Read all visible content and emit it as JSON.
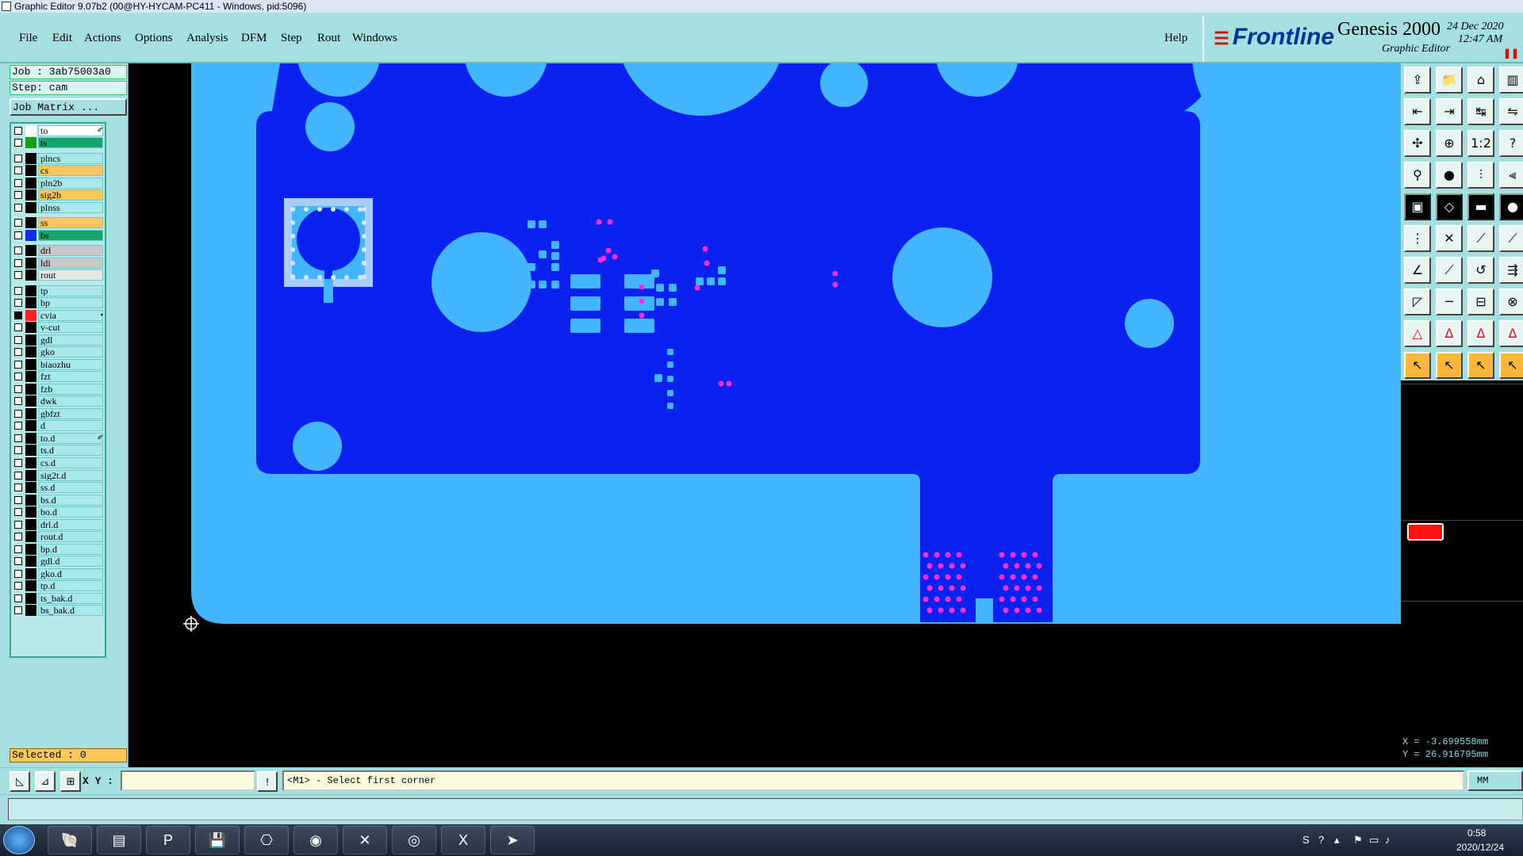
{
  "window": {
    "title": "Graphic Editor 9.07b2 (00@HY-HYCAM-PC411 - Windows, pid:5096)"
  },
  "menu": {
    "file": "File",
    "edit": "Edit",
    "actions": "Actions",
    "options": "Options",
    "analysis": "Analysis",
    "dfm": "DFM",
    "step": "Step",
    "rout": "Rout",
    "windows": "Windows",
    "help": "Help"
  },
  "brand": {
    "logo": "Frontline",
    "product": "Genesis 2000",
    "subtitle": "Graphic Editor",
    "date": "24 Dec 2020",
    "time": "12:47 AM"
  },
  "job": {
    "job": "Job : 3ab75003a0",
    "step": "Step: cam",
    "matrix": "Job Matrix ..."
  },
  "layers": [
    {
      "name": "to",
      "swatch": "#ffffff",
      "bg": "#ffffff",
      "checked": false,
      "flag": "✐"
    },
    {
      "name": "ts",
      "swatch": "#1a9a1a",
      "bg": "#14a46c",
      "checked": false
    },
    {
      "name": "plncs",
      "swatch": "#000000",
      "bg": "#a8e8e8",
      "checked": false
    },
    {
      "name": "cs",
      "swatch": "#000000",
      "bg": "#fcc85a",
      "checked": false
    },
    {
      "name": "pln2b",
      "swatch": "#000000",
      "bg": "#a8e8e8",
      "checked": false
    },
    {
      "name": "sig2b",
      "swatch": "#000000",
      "bg": "#fcc85a",
      "checked": false
    },
    {
      "name": "plnss",
      "swatch": "#000000",
      "bg": "#a8e8e8",
      "checked": false
    },
    {
      "name": "ss",
      "swatch": "#000000",
      "bg": "#fcc85a",
      "checked": false
    },
    {
      "name": "bs",
      "swatch": "#1030e8",
      "bg": "#14a46c",
      "checked": false
    },
    {
      "name": "drl",
      "swatch": "#000000",
      "bg": "#c8c8c8",
      "checked": false
    },
    {
      "name": "ldi",
      "swatch": "#000000",
      "bg": "#c8c8c8",
      "checked": false
    },
    {
      "name": "rout",
      "swatch": "#000000",
      "bg": "#e8e8e8",
      "checked": false
    },
    {
      "name": "tp",
      "swatch": "#000000",
      "bg": "#a8e8e8",
      "checked": false
    },
    {
      "name": "bp",
      "swatch": "#000000",
      "bg": "#a8e8e8",
      "checked": false
    },
    {
      "name": "cvia",
      "swatch": "#ff2020",
      "bg": "#a8e8e8",
      "checked": true,
      "flag": "▪"
    },
    {
      "name": "v-cut",
      "swatch": "#000000",
      "bg": "#a8e8e8",
      "checked": false
    },
    {
      "name": "gdl",
      "swatch": "#000000",
      "bg": "#a8e8e8",
      "checked": false
    },
    {
      "name": "gko",
      "swatch": "#000000",
      "bg": "#a8e8e8",
      "checked": false
    },
    {
      "name": "biaozhu",
      "swatch": "#000000",
      "bg": "#a8e8e8",
      "checked": false
    },
    {
      "name": "fzt",
      "swatch": "#000000",
      "bg": "#a8e8e8",
      "checked": false
    },
    {
      "name": "fzb",
      "swatch": "#000000",
      "bg": "#a8e8e8",
      "checked": false
    },
    {
      "name": "dwk",
      "swatch": "#000000",
      "bg": "#a8e8e8",
      "checked": false
    },
    {
      "name": "gbfzt",
      "swatch": "#000000",
      "bg": "#a8e8e8",
      "checked": false
    },
    {
      "name": "d",
      "swatch": "#000000",
      "bg": "#a8e8e8",
      "checked": false
    },
    {
      "name": "to.d",
      "swatch": "#000000",
      "bg": "#a8e8e8",
      "checked": false,
      "flag": "✐"
    },
    {
      "name": "ts.d",
      "swatch": "#000000",
      "bg": "#a8e8e8",
      "checked": false
    },
    {
      "name": "cs.d",
      "swatch": "#000000",
      "bg": "#a8e8e8",
      "checked": false
    },
    {
      "name": "sig2t.d",
      "swatch": "#000000",
      "bg": "#a8e8e8",
      "checked": false
    },
    {
      "name": "ss.d",
      "swatch": "#000000",
      "bg": "#a8e8e8",
      "checked": false
    },
    {
      "name": "bs.d",
      "swatch": "#000000",
      "bg": "#a8e8e8",
      "checked": false
    },
    {
      "name": "bo.d",
      "swatch": "#000000",
      "bg": "#a8e8e8",
      "checked": false
    },
    {
      "name": "drl.d",
      "swatch": "#000000",
      "bg": "#a8e8e8",
      "checked": false
    },
    {
      "name": "rout.d",
      "swatch": "#000000",
      "bg": "#a8e8e8",
      "checked": false
    },
    {
      "name": "bp.d",
      "swatch": "#000000",
      "bg": "#a8e8e8",
      "checked": false
    },
    {
      "name": "gdl.d",
      "swatch": "#000000",
      "bg": "#a8e8e8",
      "checked": false
    },
    {
      "name": "gko.d",
      "swatch": "#000000",
      "bg": "#a8e8e8",
      "checked": false
    },
    {
      "name": "tp.d",
      "swatch": "#000000",
      "bg": "#a8e8e8",
      "checked": false
    },
    {
      "name": "ts_bak.d",
      "swatch": "#000000",
      "bg": "#a8e8e8",
      "checked": false
    },
    {
      "name": "bs_bak.d",
      "swatch": "#000000",
      "bg": "#a8e8e8",
      "checked": false
    }
  ],
  "selected": "Selected : 0",
  "coords": {
    "x": "X = -3.699558mm",
    "y": "Y = 26.916795mm"
  },
  "command": {
    "xy_label": "X Y :",
    "xy_value": "",
    "prompt": "<M1> - Select first corner",
    "unit": "MM"
  },
  "taskbar": {
    "time": "0:58",
    "date": "2020/12/24"
  },
  "colors": {
    "board": "#44b6ff",
    "copper": "#0a22ee",
    "via": "#ff30d8",
    "panel": "#a6dfe0"
  }
}
